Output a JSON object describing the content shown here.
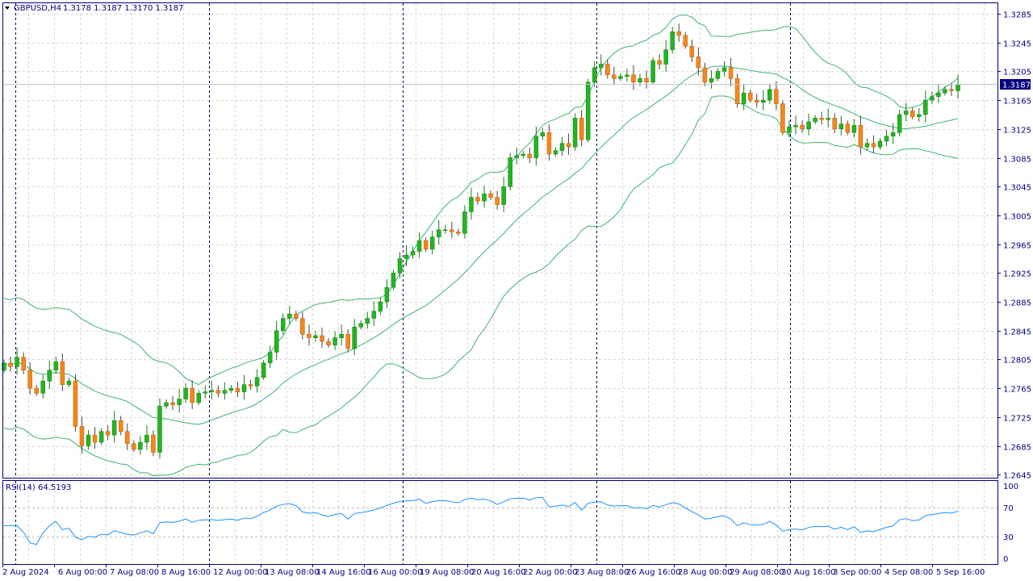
{
  "header": {
    "symbol": "GBPUSD,H4",
    "ohlc_readout": "1.3178 1.3187 1.3170 1.3187"
  },
  "rsi_panel": {
    "label": "RSI(14) 64.5193",
    "levels": [
      "100",
      "70",
      "30",
      "0"
    ]
  },
  "colors": {
    "bull": "#22b522",
    "bear": "#f5861f",
    "bands": "#3cb371",
    "rsi": "#1e90ff",
    "axis": "#000080",
    "price_tag_bg": "#000080"
  },
  "chart_data": {
    "type": "candlestick",
    "symbol": "GBPUSD",
    "timeframe": "H4",
    "indicators": [
      "Bollinger Bands",
      "RSI(14)"
    ],
    "current_price": "1.3187",
    "ylim": [
      1.2625,
      1.3305
    ],
    "y_ticks": [
      "1.3285",
      "1.3245",
      "1.3205",
      "1.3165",
      "1.3125",
      "1.3085",
      "1.3045",
      "1.3005",
      "1.2965",
      "1.2925",
      "1.2885",
      "1.2845",
      "1.2805",
      "1.2765",
      "1.2725",
      "1.2685",
      "1.2645"
    ],
    "x_ticks": [
      "2 Aug 2024",
      "6 Aug 00:00",
      "7 Aug 08:00",
      "8 Aug 16:00",
      "12 Aug 00:00",
      "13 Aug 08:00",
      "14 Aug 16:00",
      "16 Aug 00:00",
      "19 Aug 08:00",
      "20 Aug 16:00",
      "22 Aug 00:00",
      "23 Aug 08:00",
      "26 Aug 16:00",
      "28 Aug 00:00",
      "29 Aug 08:00",
      "30 Aug 16:00",
      "3 Sep 00:00",
      "4 Sep 08:00",
      "5 Sep 16:00"
    ],
    "first_open": 1.279,
    "closes": [
      1.28,
      1.2795,
      1.2808,
      1.279,
      1.2765,
      1.2758,
      1.2775,
      1.279,
      1.2802,
      1.277,
      1.2775,
      1.2712,
      1.2685,
      1.27,
      1.269,
      1.2705,
      1.27,
      1.272,
      1.2705,
      1.2688,
      1.268,
      1.269,
      1.27,
      1.2676,
      1.274,
      1.2745,
      1.2742,
      1.275,
      1.2765,
      1.2745,
      1.2758,
      1.276,
      1.2762,
      1.2758,
      1.2762,
      1.2765,
      1.276,
      1.277,
      1.2768,
      1.278,
      1.28,
      1.2815,
      1.2845,
      1.2862,
      1.2868,
      1.2862,
      1.284,
      1.2835,
      1.2838,
      1.283,
      1.2825,
      1.2835,
      1.284,
      1.282,
      1.285,
      1.2855,
      1.2862,
      1.2872,
      1.2885,
      1.2905,
      1.2925,
      1.2945,
      1.295,
      1.2955,
      1.297,
      1.2958,
      1.2975,
      1.2985,
      1.2985,
      1.2982,
      1.298,
      1.301,
      1.303,
      1.3025,
      1.3035,
      1.303,
      1.302,
      1.3045,
      1.3085,
      1.3088,
      1.309,
      1.3085,
      1.3115,
      1.312,
      1.309,
      1.3095,
      1.3105,
      1.31,
      1.314,
      1.311,
      1.319,
      1.321,
      1.3215,
      1.32,
      1.3195,
      1.3198,
      1.32,
      1.319,
      1.3195,
      1.319,
      1.322,
      1.3215,
      1.3235,
      1.326,
      1.3255,
      1.324,
      1.3225,
      1.321,
      1.319,
      1.3195,
      1.3205,
      1.321,
      1.3195,
      1.316,
      1.3175,
      1.3165,
      1.3162,
      1.3165,
      1.318,
      1.316,
      1.312,
      1.3128,
      1.313,
      1.3125,
      1.3135,
      1.314,
      1.3138,
      1.314,
      1.3125,
      1.3132,
      1.312,
      1.313,
      1.31,
      1.3105,
      1.31,
      1.3108,
      1.3115,
      1.312,
      1.3145,
      1.315,
      1.3142,
      1.3145,
      1.3165,
      1.317,
      1.3175,
      1.318,
      1.3178,
      1.3187
    ],
    "rsi_ylim": [
      0,
      100
    ],
    "rsi_levels": [
      70,
      30
    ]
  }
}
